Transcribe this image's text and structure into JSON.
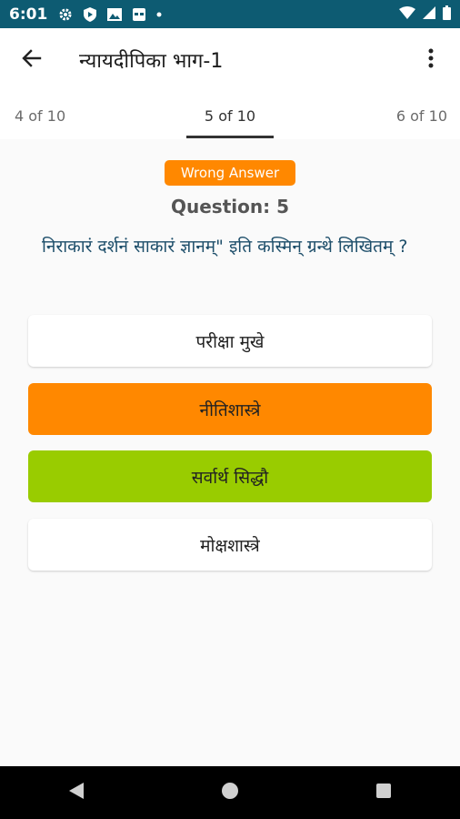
{
  "status_bar": {
    "time": "6:01",
    "left_icons": [
      "settings-icon",
      "shield-play-icon",
      "image-icon",
      "calendar-icon",
      "dot-icon"
    ],
    "right_icons": [
      "wifi-icon",
      "signal-icon",
      "battery-icon"
    ]
  },
  "app_bar": {
    "title": "न्यायदीपिका भाग-1",
    "back_icon": "arrow-back-icon",
    "menu_icon": "more-vert-icon"
  },
  "pager": {
    "prev": "4 of  10",
    "current": "5 of  10",
    "next": "6 of  10"
  },
  "question": {
    "status_badge": "Wrong Answer",
    "number_label": "Question: 5",
    "text": "निराकारं दर्शनं साकारं ज्ञानम्\" इति कस्मिन् ग्रन्थे लिखितम् ?",
    "options": [
      {
        "label": "परीक्षा मुखे",
        "state": "normal"
      },
      {
        "label": "नीतिशास्त्रे",
        "state": "wrong"
      },
      {
        "label": "सर्वार्थ सिद्धौ",
        "state": "correct"
      },
      {
        "label": "मोक्षशास्त्रे",
        "state": "normal"
      }
    ]
  },
  "colors": {
    "status_bar": "#0d5b72",
    "wrong": "#ff8800",
    "correct": "#99cc00",
    "question_text": "#1d4e6a"
  },
  "nav_bar": {
    "buttons": [
      "back-triangle-icon",
      "home-circle-icon",
      "recents-square-icon"
    ]
  }
}
